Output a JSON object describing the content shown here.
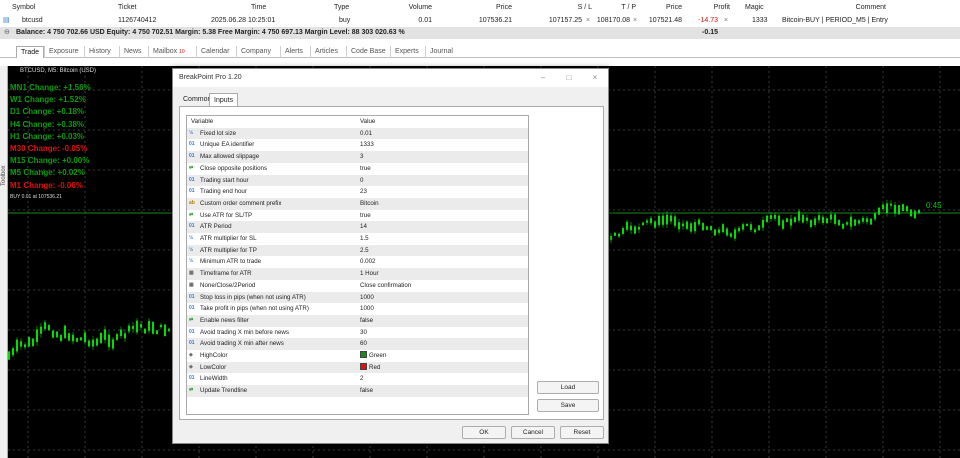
{
  "trade_table": {
    "headers": [
      "Symbol",
      "Ticket",
      "Time",
      "Type",
      "Volume",
      "Price",
      "S / L",
      "T / P",
      "Price",
      "Profit",
      "Magic",
      "Comment"
    ],
    "row": {
      "symbol": "btcusd",
      "ticket": "1126740412",
      "time": "2025.06.28 10:25:01",
      "type": "buy",
      "volume": "0.01",
      "price": "107536.21",
      "sl": "107157.25",
      "tp": "108170.08",
      "current_price": "107521.48",
      "profit": "-14.73",
      "magic": "1333",
      "comment": "Bitcoin-BUY | PERIOD_M5 | Entry"
    },
    "balance_text": "Balance: 4 750 702.66 USD  Equity: 4 750 702.51  Margin: 5.38  Free Margin: 4 750 697.13  Margin Level: 88 303 020.63 %",
    "balance_profit": "-0.15"
  },
  "bottom_tabs": [
    "Trade",
    "Exposure",
    "History",
    "News",
    "Mailbox",
    "Calendar",
    "Company",
    "Alerts",
    "Articles",
    "Code Base",
    "Experts",
    "Journal"
  ],
  "mailbox_badge": "10",
  "toolbox_label": "Toolbox",
  "chart": {
    "title": "BTCUSD, M5: Bitcoin (USD)",
    "indicators": [
      {
        "text": "MN1 Change: +1.56%",
        "color": "green"
      },
      {
        "text": "W1 Change: +1.52%",
        "color": "green"
      },
      {
        "text": "D1 Change: +0.18%",
        "color": "green"
      },
      {
        "text": "H4 Change: +0.38%",
        "color": "green"
      },
      {
        "text": "H1 Change: +0.03%",
        "color": "green"
      },
      {
        "text": "M30 Change: -0.05%",
        "color": "red"
      },
      {
        "text": "M15 Change: +0.00%",
        "color": "green"
      },
      {
        "text": "M5 Change: +0.02%",
        "color": "green"
      },
      {
        "text": "M1 Change: -0.06%",
        "color": "red"
      }
    ],
    "buy_line_label": "BUY 0.01 at 107536.21",
    "price_tag": "0:45"
  },
  "dialog": {
    "title": "BreakPoint Pro 1.20",
    "tabs": [
      "Common",
      "Inputs"
    ],
    "grid_headers": [
      "Variable",
      "Value"
    ],
    "params": [
      {
        "icon": "½",
        "type": "double",
        "name": "Fixed lot size",
        "value": "0.01"
      },
      {
        "icon": "01",
        "type": "int",
        "name": "Unique EA identifier",
        "value": "1333"
      },
      {
        "icon": "01",
        "type": "int",
        "name": "Max allowed slippage",
        "value": "3"
      },
      {
        "icon": "⇄",
        "type": "bool",
        "name": "Close opposite positions",
        "value": "true"
      },
      {
        "icon": "01",
        "type": "int",
        "name": "Trading start hour",
        "value": "0"
      },
      {
        "icon": "01",
        "type": "int",
        "name": "Trading end hour",
        "value": "23"
      },
      {
        "icon": "ab",
        "type": "str",
        "name": "Custom order comment prefix",
        "value": "Bitcoin"
      },
      {
        "icon": "⇄",
        "type": "bool",
        "name": "Use ATR for SL/TP",
        "value": "true"
      },
      {
        "icon": "01",
        "type": "int",
        "name": "ATR Period",
        "value": "14"
      },
      {
        "icon": "½",
        "type": "double",
        "name": "ATR multiplier for SL",
        "value": "1.5"
      },
      {
        "icon": "½",
        "type": "double",
        "name": "ATR multiplier for TP",
        "value": "2.5"
      },
      {
        "icon": "½",
        "type": "double",
        "name": "Minimum ATR to trade",
        "value": "0.002"
      },
      {
        "icon": "▦",
        "type": "col",
        "name": "Timeframe for ATR",
        "value": "1 Hour"
      },
      {
        "icon": "▦",
        "type": "col",
        "name": "None/Close/2Period",
        "value": "Close confirmation"
      },
      {
        "icon": "01",
        "type": "int",
        "name": "Stop loss in pips (when not using ATR)",
        "value": "1000"
      },
      {
        "icon": "01",
        "type": "int",
        "name": "Take profit in pips (when not using ATR)",
        "value": "1000"
      },
      {
        "icon": "⇄",
        "type": "bool",
        "name": "Enable news filter",
        "value": "false"
      },
      {
        "icon": "01",
        "type": "int",
        "name": "Avoid trading X min before news",
        "value": "30"
      },
      {
        "icon": "01",
        "type": "int",
        "name": "Avoid trading X min after news",
        "value": "60"
      },
      {
        "icon": "◈",
        "type": "col",
        "name": "HighColor",
        "value": "Green",
        "swatch": "#1a8a1a"
      },
      {
        "icon": "◈",
        "type": "col",
        "name": "LowColor",
        "value": "Red",
        "swatch": "#e01010"
      },
      {
        "icon": "01",
        "type": "int",
        "name": "LineWidth",
        "value": "2"
      },
      {
        "icon": "⇄",
        "type": "bool",
        "name": "Update Trendline",
        "value": "false"
      }
    ],
    "side_buttons": {
      "load": "Load",
      "save": "Save"
    },
    "footer_buttons": {
      "ok": "OK",
      "cancel": "Cancel",
      "reset": "Reset"
    }
  },
  "colors": {
    "candle_green": "#00e000",
    "grid": "#3a3a3a",
    "buy_line": "#1a8a1a"
  }
}
